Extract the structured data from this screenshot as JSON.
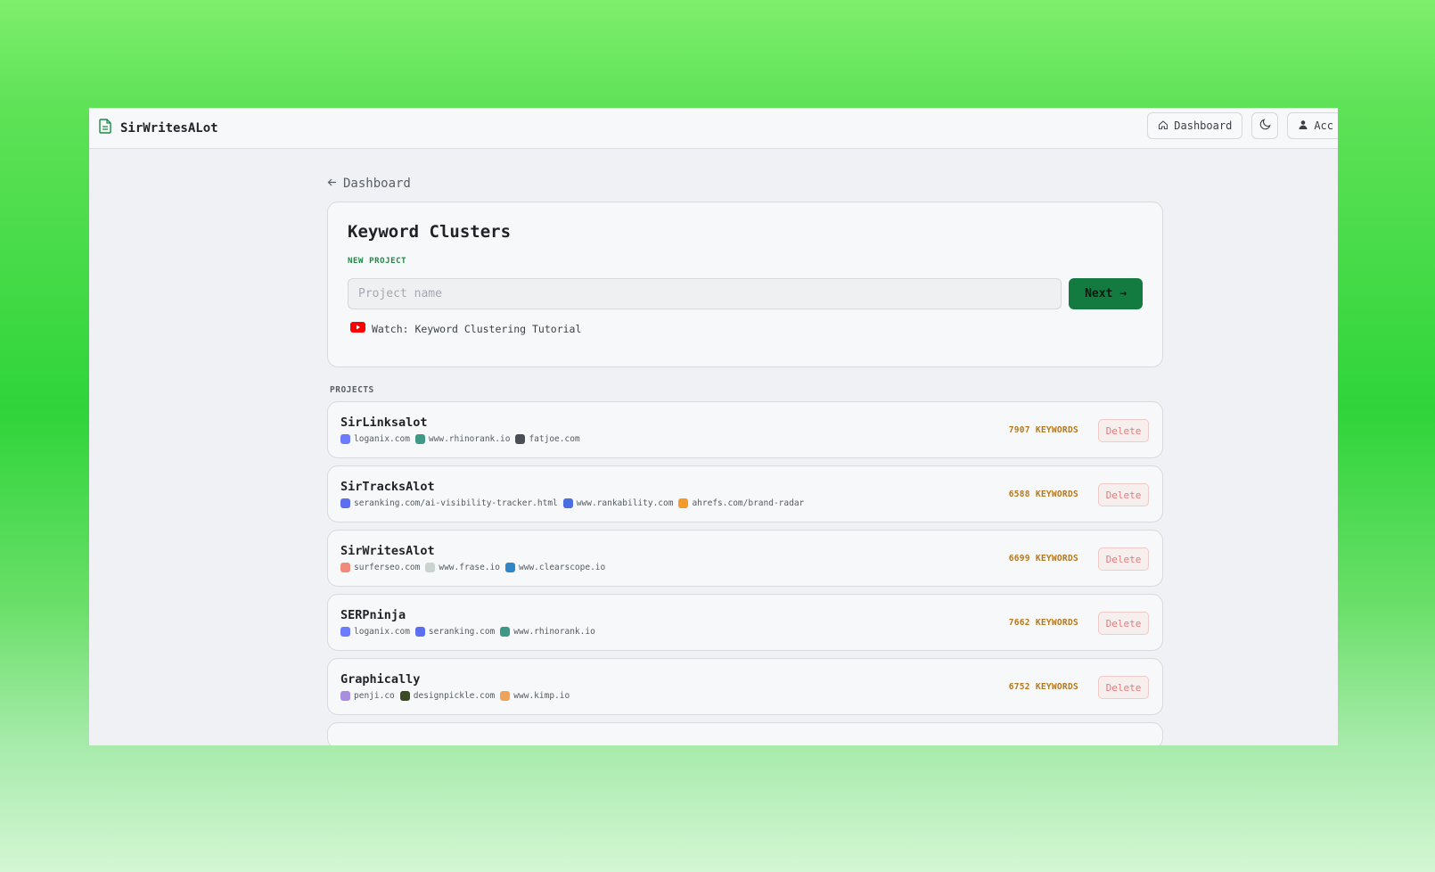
{
  "app": {
    "title": "SirWritesALot"
  },
  "topbar": {
    "dashboard_label": "Dashboard",
    "account_label": "Acc"
  },
  "nav": {
    "back_label": "Dashboard"
  },
  "new_project": {
    "title": "Keyword Clusters",
    "section_label": "NEW PROJECT",
    "input_placeholder": "Project name",
    "input_value": "",
    "next_label": "Next →",
    "tutorial_label": "Watch: Keyword Clustering Tutorial"
  },
  "projects": {
    "section_label": "PROJECTS",
    "delete_label": "Delete",
    "items": [
      {
        "name": "SirLinksalot",
        "keywords": "7907 KEYWORDS",
        "sites": [
          {
            "domain": "loganix.com",
            "icon": "loganix-icon",
            "color": "#6b7cff"
          },
          {
            "domain": "www.rhinorank.io",
            "icon": "rhinorank-icon",
            "color": "#3e9a86"
          },
          {
            "domain": "fatjoe.com",
            "icon": "fatjoe-icon",
            "color": "#4b4f55"
          }
        ]
      },
      {
        "name": "SirTracksAlot",
        "keywords": "6588 KEYWORDS",
        "sites": [
          {
            "domain": "seranking.com/ai-visibility-tracker.html",
            "icon": "seranking-icon",
            "color": "#5b6ff0"
          },
          {
            "domain": "www.rankability.com",
            "icon": "rankability-icon",
            "color": "#4a6fe0"
          },
          {
            "domain": "ahrefs.com/brand-radar",
            "icon": "ahrefs-icon",
            "color": "#f39a2b"
          }
        ]
      },
      {
        "name": "SirWritesAlot",
        "keywords": "6699 KEYWORDS",
        "sites": [
          {
            "domain": "surferseo.com",
            "icon": "surferseo-icon",
            "color": "#f08a7a"
          },
          {
            "domain": "www.frase.io",
            "icon": "frase-icon",
            "color": "#c9d3cf"
          },
          {
            "domain": "www.clearscope.io",
            "icon": "clearscope-icon",
            "color": "#2f86c8"
          }
        ]
      },
      {
        "name": "SERPninja",
        "keywords": "7662 KEYWORDS",
        "sites": [
          {
            "domain": "loganix.com",
            "icon": "loganix-icon",
            "color": "#6b7cff"
          },
          {
            "domain": "seranking.com",
            "icon": "seranking-icon",
            "color": "#5b6ff0"
          },
          {
            "domain": "www.rhinorank.io",
            "icon": "rhinorank-icon",
            "color": "#3e9a86"
          }
        ]
      },
      {
        "name": "Graphically",
        "keywords": "6752 KEYWORDS",
        "sites": [
          {
            "domain": "penji.co",
            "icon": "penji-icon",
            "color": "#a98de0"
          },
          {
            "domain": "designpickle.com",
            "icon": "designpickle-icon",
            "color": "#3a4a22"
          },
          {
            "domain": "www.kimp.io",
            "icon": "kimp-icon",
            "color": "#f0a25a"
          }
        ]
      }
    ]
  },
  "colors": {
    "accent": "#137a40",
    "keywords": "#b7771b",
    "delete": "#e6797b",
    "youtube": "#ff0000"
  }
}
